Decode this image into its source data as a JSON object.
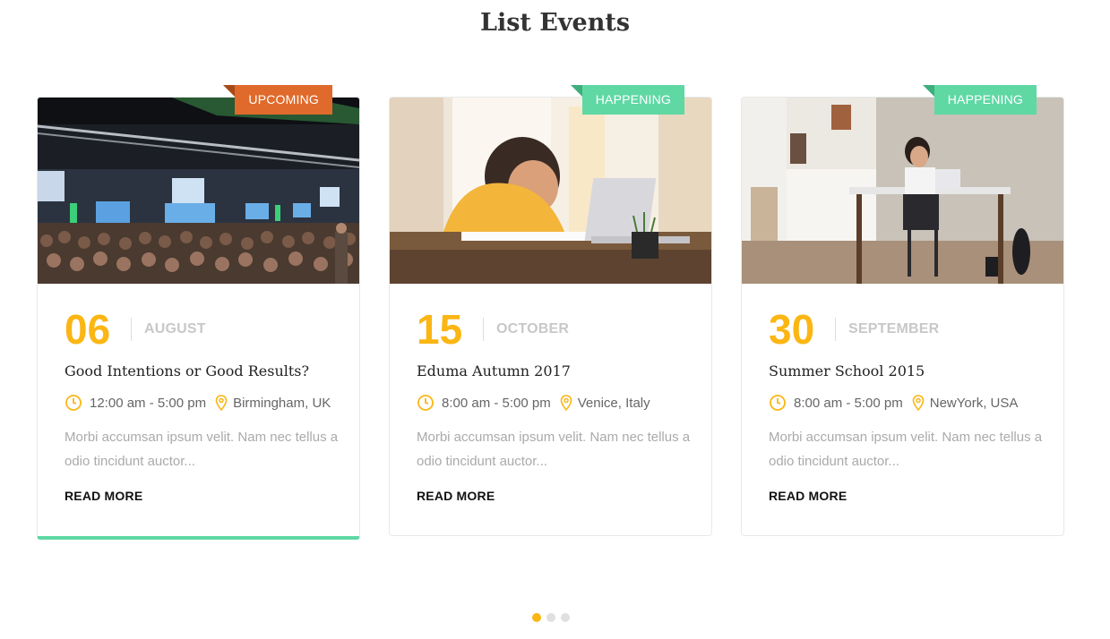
{
  "section": {
    "title": "List Events"
  },
  "events": [
    {
      "status": "UPCOMING",
      "day": "06",
      "month": "AUGUST",
      "title": "Good Intentions or Good Results?",
      "time": "12:00 am - 5:00 pm",
      "location": "Birmingham, UK",
      "excerpt": "Morbi accumsan ipsum velit. Nam nec tellus a odio tincidunt auctor...",
      "read_more": "READ MORE"
    },
    {
      "status": "HAPPENING",
      "day": "15",
      "month": "OCTOBER",
      "title": "Eduma Autumn 2017",
      "time": "8:00 am - 5:00 pm",
      "location": "Venice, Italy",
      "excerpt": "Morbi accumsan ipsum velit. Nam nec tellus a odio tincidunt auctor...",
      "read_more": "READ MORE"
    },
    {
      "status": "HAPPENING",
      "day": "30",
      "month": "SEPTEMBER",
      "title": "Summer School 2015",
      "time": "8:00 am - 5:00 pm",
      "location": "NewYork, USA",
      "excerpt": "Morbi accumsan ipsum velit. Nam nec tellus a odio tincidunt auctor...",
      "read_more": "READ MORE"
    }
  ],
  "carousel": {
    "pages": 3,
    "active_page": 1
  },
  "colors": {
    "accent": "#fbb614",
    "upcoming": "#e06a2b",
    "happening": "#5fd8a4",
    "muted": "#aaaaaa"
  },
  "icons": {
    "time": "clock-icon",
    "location": "map-pin-icon"
  }
}
